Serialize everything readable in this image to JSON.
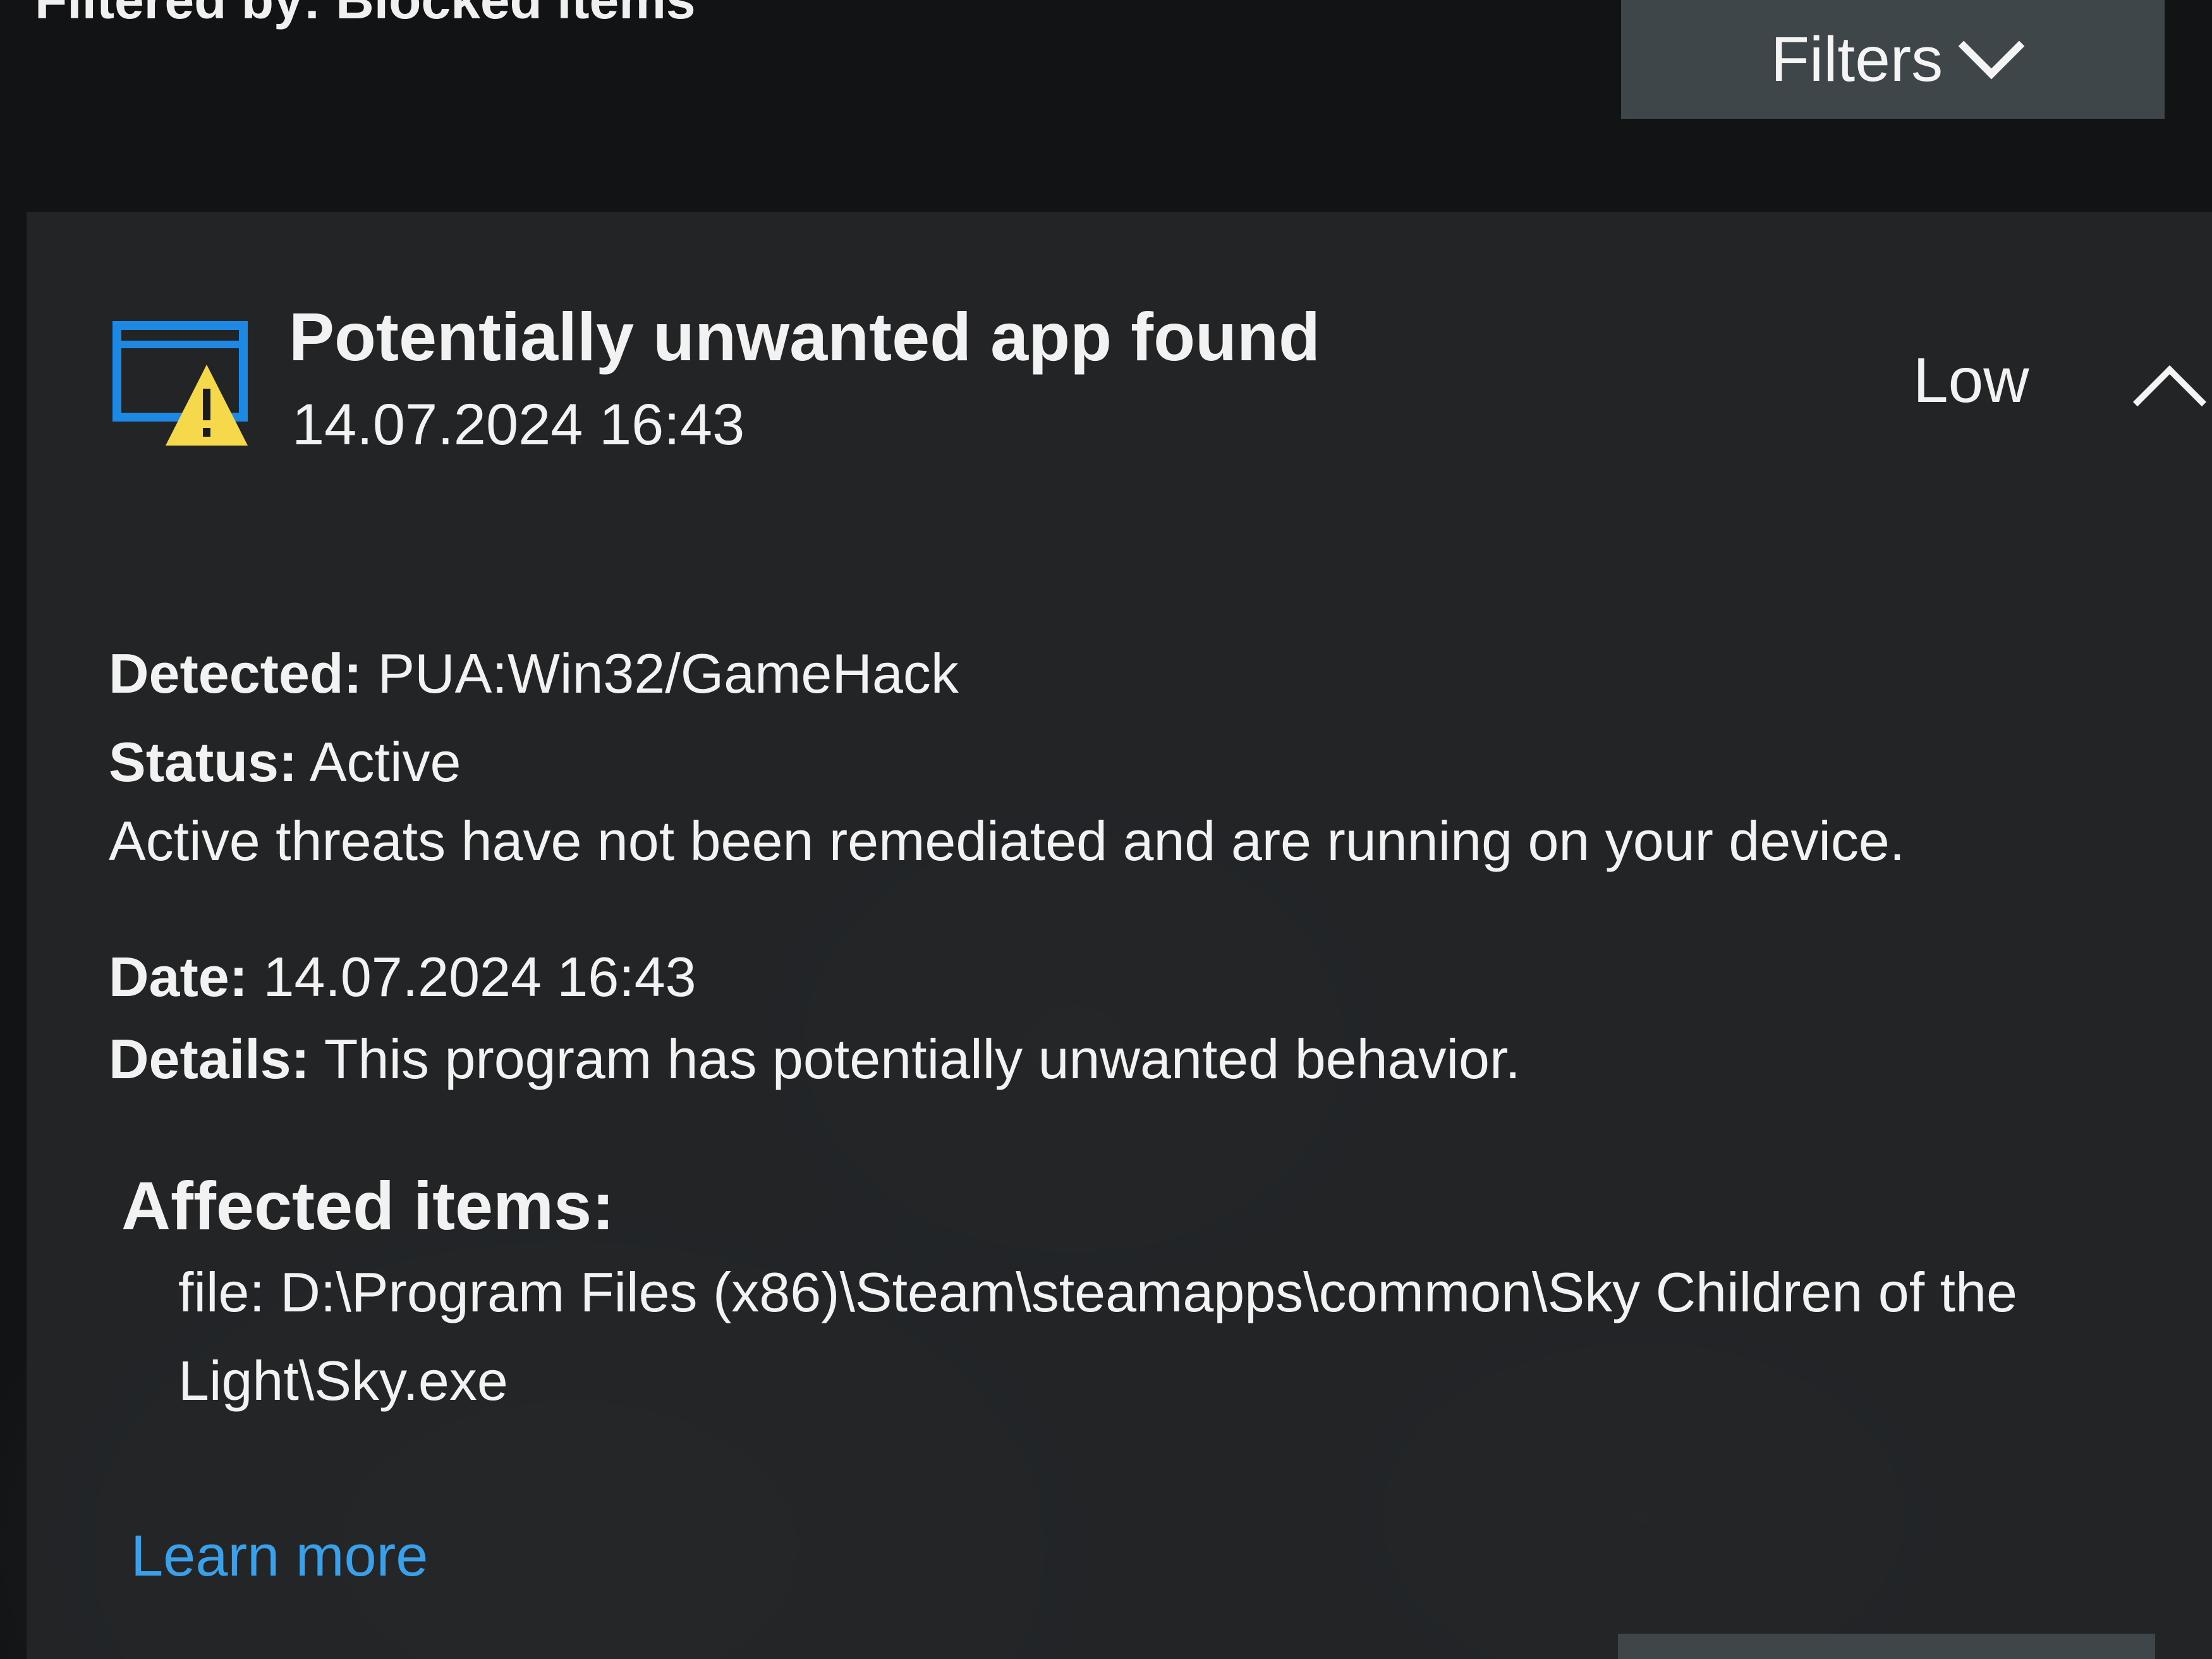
{
  "filter_bar": {
    "filtered_by": "Filtered by: Blocked items",
    "filters_button_label": "Filters",
    "filters_icon": "chevron-down-icon"
  },
  "threat": {
    "icon": "warning-window-icon",
    "title": "Potentially unwanted app found",
    "timestamp": "14.07.2024 16:43",
    "severity": "Low",
    "collapse_icon": "chevron-up-icon",
    "detected_label": "Detected:",
    "detected_value": "PUA:Win32/GameHack",
    "status_label": "Status:",
    "status_value": "Active",
    "status_message": "Active threats have not been remediated and are running on your device.",
    "date_label": "Date:",
    "date_value": "14.07.2024 16:43",
    "details_label": "Details:",
    "details_value": "This program has potentially unwanted behavior.",
    "affected_heading": "Affected items:",
    "affected_items": [
      "file: D:\\Program Files (x86)\\Steam\\steamapps\\common\\Sky Children of the Light\\Sky.exe"
    ],
    "learn_more": "Learn more"
  },
  "colors": {
    "accent": "#3aa0ea",
    "icon_blue": "#1e88e5",
    "warning_yellow": "#f5d94a",
    "card_background": "#242628",
    "button_background": "#3f4649"
  }
}
